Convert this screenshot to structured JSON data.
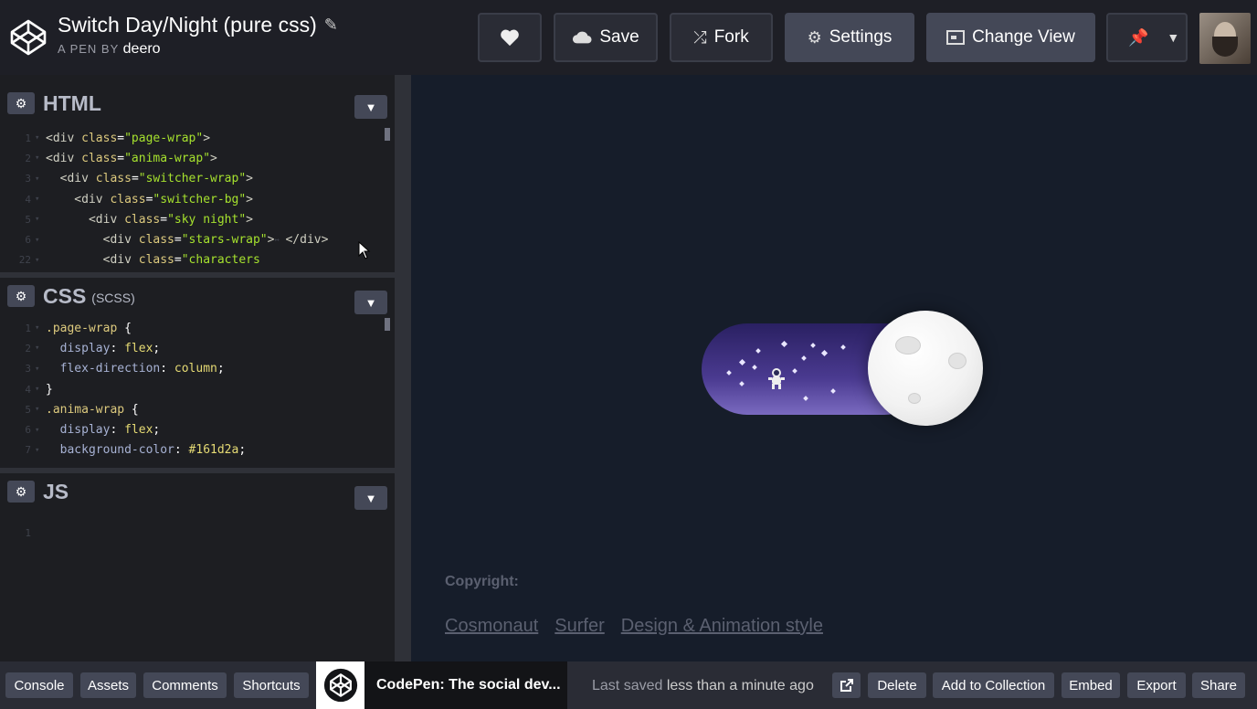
{
  "header": {
    "pen_title": "Switch Day/Night (pure css)",
    "byline_prefix": "A PEN BY",
    "author": "deero",
    "buttons": {
      "save": "Save",
      "fork": "Fork",
      "settings": "Settings",
      "change_view": "Change View"
    }
  },
  "editors": {
    "html": {
      "title": "HTML",
      "lines": [
        {
          "n": "1",
          "parts": [
            [
              "tag",
              "<div "
            ],
            [
              "attr",
              "class"
            ],
            [
              "punc",
              "="
            ],
            [
              "str",
              "\"page-wrap\""
            ],
            [
              "tag",
              ">"
            ]
          ]
        },
        {
          "n": "2",
          "parts": [
            [
              "tag",
              "<div "
            ],
            [
              "attr",
              "class"
            ],
            [
              "punc",
              "="
            ],
            [
              "str",
              "\"anima-wrap\""
            ],
            [
              "tag",
              ">"
            ]
          ]
        },
        {
          "n": "3",
          "parts": [
            [
              "tag",
              "  <div "
            ],
            [
              "attr",
              "class"
            ],
            [
              "punc",
              "="
            ],
            [
              "str",
              "\"switcher-wrap\""
            ],
            [
              "tag",
              ">"
            ]
          ]
        },
        {
          "n": "4",
          "parts": [
            [
              "tag",
              "    <div "
            ],
            [
              "attr",
              "class"
            ],
            [
              "punc",
              "="
            ],
            [
              "str",
              "\"switcher-bg\""
            ],
            [
              "tag",
              ">"
            ]
          ]
        },
        {
          "n": "5",
          "parts": [
            [
              "tag",
              "      <div "
            ],
            [
              "attr",
              "class"
            ],
            [
              "punc",
              "="
            ],
            [
              "str",
              "\"sky night\""
            ],
            [
              "tag",
              ">"
            ]
          ]
        },
        {
          "n": "6",
          "parts": [
            [
              "tag",
              "        <div "
            ],
            [
              "attr",
              "class"
            ],
            [
              "punc",
              "="
            ],
            [
              "str",
              "\"stars-wrap\""
            ],
            [
              "tag",
              ">"
            ],
            [
              "fold",
              "↔"
            ],
            [
              "tag",
              "</div>"
            ]
          ]
        },
        {
          "n": "22",
          "parts": [
            [
              "tag",
              "        <div "
            ],
            [
              "attr",
              "class"
            ],
            [
              "punc",
              "="
            ],
            [
              "str",
              "\"characters"
            ]
          ]
        }
      ]
    },
    "css": {
      "title": "CSS",
      "subtitle": "(SCSS)",
      "lines": [
        {
          "n": "1",
          "parts": [
            [
              "sel",
              ".page-wrap "
            ],
            [
              "punc",
              "{"
            ]
          ]
        },
        {
          "n": "2",
          "parts": [
            [
              "prop",
              "  display"
            ],
            [
              "punc",
              ": "
            ],
            [
              "val",
              "flex"
            ],
            [
              "punc",
              ";"
            ]
          ]
        },
        {
          "n": "3",
          "parts": [
            [
              "prop",
              "  flex-direction"
            ],
            [
              "punc",
              ": "
            ],
            [
              "val",
              "column"
            ],
            [
              "punc",
              ";"
            ]
          ]
        },
        {
          "n": "4",
          "parts": [
            [
              "punc",
              "}"
            ]
          ]
        },
        {
          "n": "5",
          "parts": [
            [
              "sel",
              ".anima-wrap "
            ],
            [
              "punc",
              "{"
            ]
          ]
        },
        {
          "n": "6",
          "parts": [
            [
              "prop",
              "  display"
            ],
            [
              "punc",
              ": "
            ],
            [
              "val",
              "flex"
            ],
            [
              "punc",
              ";"
            ]
          ]
        },
        {
          "n": "7",
          "parts": [
            [
              "prop",
              "  background-color"
            ],
            [
              "punc",
              ": "
            ],
            [
              "val",
              "#161d2a"
            ],
            [
              "punc",
              ";"
            ]
          ]
        }
      ]
    },
    "js": {
      "title": "JS",
      "lines": [
        {
          "n": "1",
          "parts": []
        }
      ]
    }
  },
  "preview": {
    "copyright_label": "Copyright:",
    "credits": [
      "Cosmonaut",
      "Surfer",
      "Design & Animation style"
    ]
  },
  "footer": {
    "buttons": [
      "Console",
      "Assets",
      "Comments",
      "Shortcuts"
    ],
    "codepen_tab": "CodePen: The social dev...",
    "saved_prefix": "Last saved",
    "saved_time": "less than a minute ago",
    "actions": [
      "Delete",
      "Add to Collection",
      "Embed",
      "Export",
      "Share"
    ]
  },
  "colors": {
    "preview_bg": "#161d2a",
    "header_bg": "#1e1f26",
    "editor_bg": "#1d1e22",
    "button_bg": "#444857"
  }
}
